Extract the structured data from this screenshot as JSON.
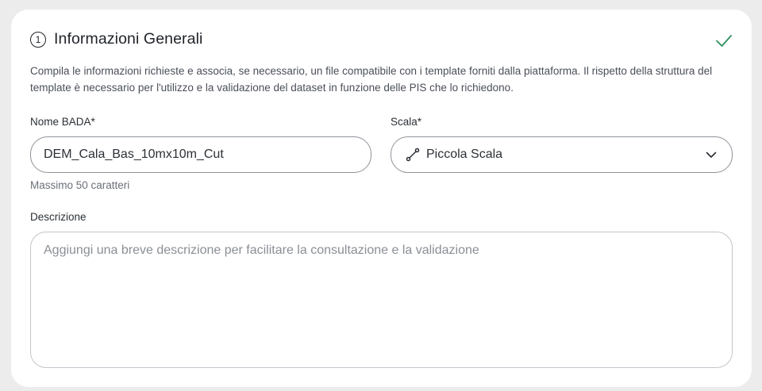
{
  "section": {
    "step_number": "1",
    "title": "Informazioni Generali",
    "status_icon": "check-icon",
    "status_color": "#2f8f5b",
    "description": "Compila le informazioni richieste e associa, se necessario, un file compatibile con i template forniti dalla piattaforma. Il rispetto della struttura del template è necessario per l'utilizzo e la validazione del dataset in funzione delle PIS che lo richiedono."
  },
  "form": {
    "name": {
      "label": "Nome BADA*",
      "value": "DEM_Cala_Bas_10mx10m_Cut",
      "hint": "Massimo 50 caratteri"
    },
    "scale": {
      "label": "Scala*",
      "value": "Piccola Scala",
      "icon": "scale-line-icon",
      "dropdown_icon": "chevron-down-icon"
    },
    "description": {
      "label": "Descrizione",
      "placeholder": "Aggiungi una breve descrizione per facilitare la consultazione e la validazione"
    }
  }
}
